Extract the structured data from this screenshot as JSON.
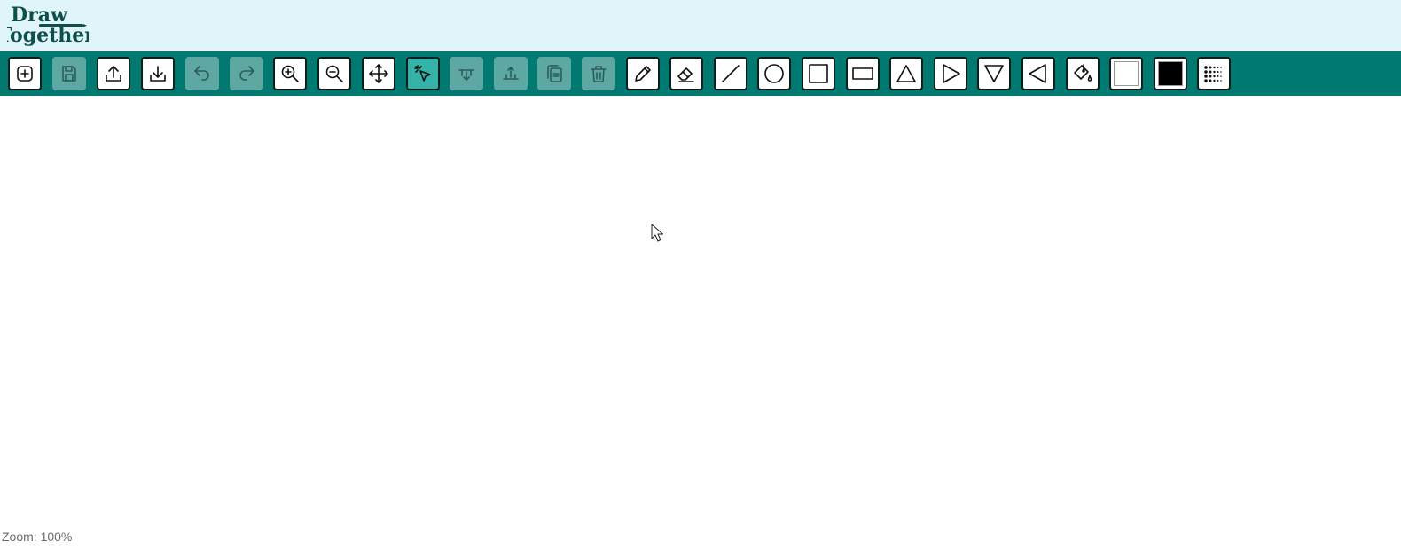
{
  "app": {
    "logo_line1": "Draw",
    "logo_line2": "Together"
  },
  "toolbar": {
    "buttons": [
      {
        "id": "new",
        "icon": "new-file-icon",
        "state": "enabled"
      },
      {
        "id": "save",
        "icon": "save-icon",
        "state": "disabled"
      },
      {
        "id": "upload",
        "icon": "upload-icon",
        "state": "enabled"
      },
      {
        "id": "download",
        "icon": "download-icon",
        "state": "enabled"
      },
      {
        "id": "undo",
        "icon": "undo-icon",
        "state": "disabled"
      },
      {
        "id": "redo",
        "icon": "redo-icon",
        "state": "disabled"
      },
      {
        "id": "zoom-in",
        "icon": "zoom-in-icon",
        "state": "enabled"
      },
      {
        "id": "zoom-out",
        "icon": "zoom-out-icon",
        "state": "enabled"
      },
      {
        "id": "pan",
        "icon": "move-icon",
        "state": "enabled"
      },
      {
        "id": "select",
        "icon": "select-cursor-icon",
        "state": "active"
      },
      {
        "id": "send-back",
        "icon": "send-backward-icon",
        "state": "disabled"
      },
      {
        "id": "bring-front",
        "icon": "bring-forward-icon",
        "state": "disabled"
      },
      {
        "id": "copy",
        "icon": "copy-icon",
        "state": "disabled"
      },
      {
        "id": "delete",
        "icon": "trash-icon",
        "state": "disabled"
      },
      {
        "id": "pencil",
        "icon": "pencil-icon",
        "state": "enabled"
      },
      {
        "id": "eraser",
        "icon": "eraser-icon",
        "state": "enabled"
      },
      {
        "id": "line",
        "icon": "line-icon",
        "state": "enabled"
      },
      {
        "id": "circle",
        "icon": "circle-icon",
        "state": "enabled"
      },
      {
        "id": "square",
        "icon": "square-icon",
        "state": "enabled"
      },
      {
        "id": "rectangle",
        "icon": "rectangle-icon",
        "state": "enabled"
      },
      {
        "id": "triangle-up",
        "icon": "triangle-up-icon",
        "state": "enabled"
      },
      {
        "id": "triangle-right",
        "icon": "triangle-right-icon",
        "state": "enabled"
      },
      {
        "id": "triangle-down",
        "icon": "triangle-down-icon",
        "state": "enabled"
      },
      {
        "id": "triangle-left",
        "icon": "triangle-left-icon",
        "state": "enabled"
      },
      {
        "id": "fill",
        "icon": "paint-bucket-icon",
        "state": "enabled"
      },
      {
        "id": "fill-color",
        "icon": "fill-color-swatch",
        "state": "swatch",
        "color": "#ffffff"
      },
      {
        "id": "stroke-color",
        "icon": "stroke-color-swatch",
        "state": "swatch",
        "color": "#000000"
      },
      {
        "id": "stroke-style",
        "icon": "dotted-grid-icon",
        "state": "enabled"
      }
    ]
  },
  "colors": {
    "header_bg": "#e0f5fa",
    "toolbar_bg": "#007a70",
    "active_bg": "#36b3a8",
    "disabled_bg": "#5ea8a3",
    "logo": "#0e4f4a"
  },
  "status": {
    "zoom": "Zoom: 100%"
  }
}
